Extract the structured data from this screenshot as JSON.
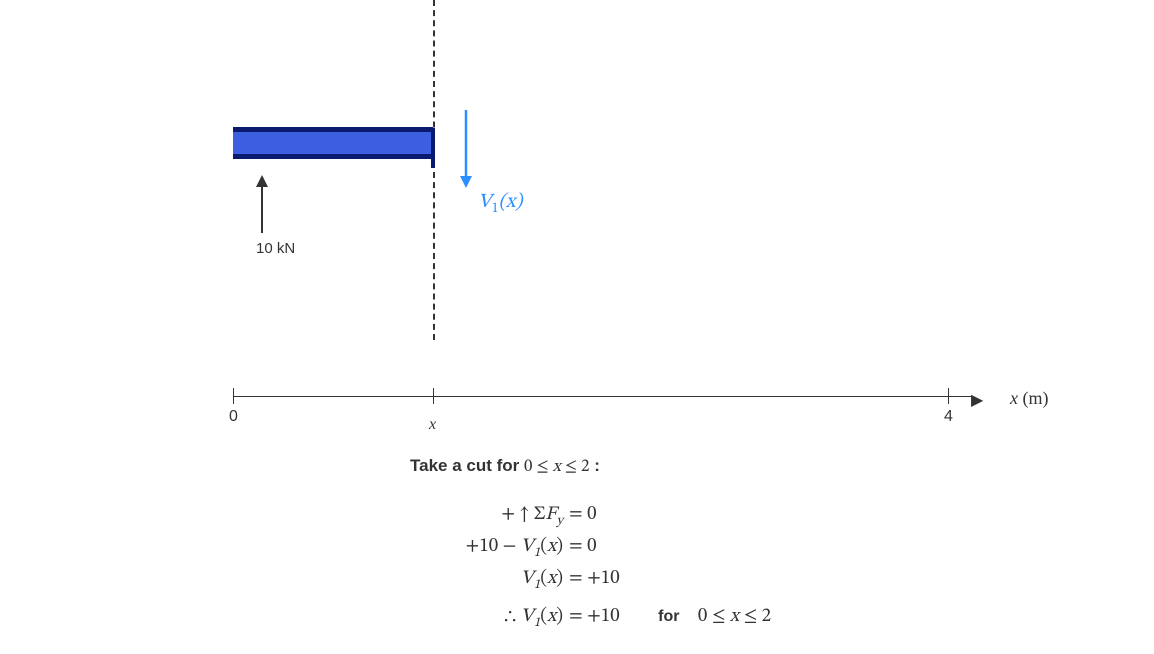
{
  "beam": {
    "reaction_force_label": "10 kN"
  },
  "shear": {
    "symbol_html": "V<sub>1</sub>(x)"
  },
  "axis": {
    "ticks": {
      "t0": "0",
      "tx": "x",
      "t4": "4"
    },
    "title_var": "x",
    "title_unit": "(m)"
  },
  "caption": {
    "prefix": "Take a cut for ",
    "range": "0 ≤ x ≤ 2",
    "suffix": " :"
  },
  "equations": {
    "r1_left": "+ ↑ ΣF",
    "r1_sub": "y",
    "r1_right": "= 0",
    "r2_left": "+10 − V",
    "r2_sub": "1",
    "r2_arg": "(x)",
    "r2_right": "= 0",
    "r3_left": "V",
    "r3_sub": "1",
    "r3_arg": "(x)",
    "r3_right": "= +10",
    "r4_pre": "∴ V",
    "r4_sub": "1",
    "r4_arg": "(x)",
    "r4_right": "= +10",
    "r4_for": "for",
    "r4_range": "0 ≤ x ≤ 2"
  }
}
